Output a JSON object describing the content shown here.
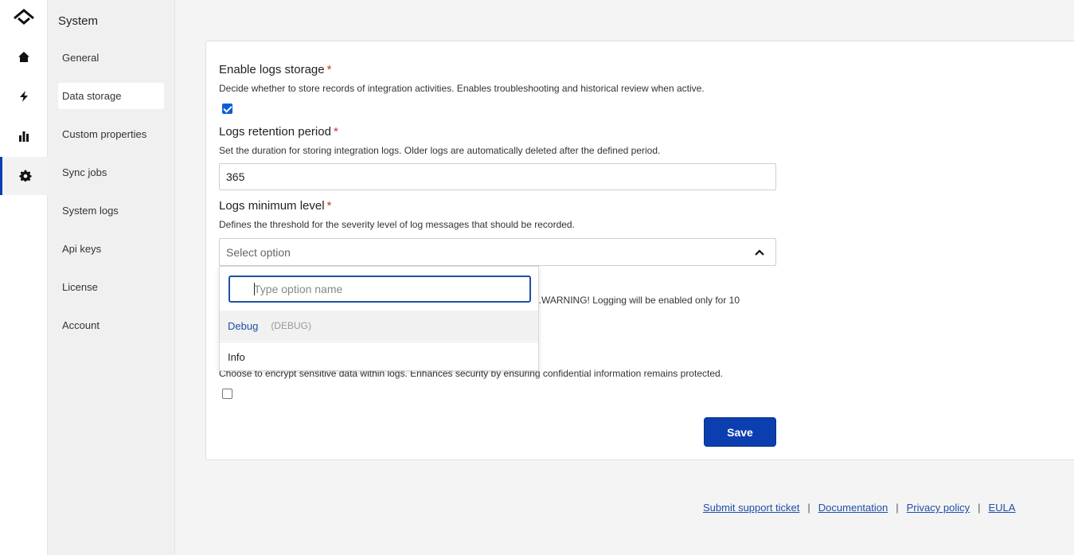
{
  "rail": {
    "items": [
      {
        "icon": "home-icon"
      },
      {
        "icon": "lightning-icon"
      },
      {
        "icon": "bar-chart-icon"
      },
      {
        "icon": "gear-icon",
        "active": true
      }
    ],
    "active_color": "#0b3fb0"
  },
  "subnav": {
    "title": "System",
    "items": [
      {
        "label": "General"
      },
      {
        "label": "Data storage",
        "active": true
      },
      {
        "label": "Custom properties"
      },
      {
        "label": "Sync jobs"
      },
      {
        "label": "System logs"
      },
      {
        "label": "Api keys"
      },
      {
        "label": "License"
      },
      {
        "label": "Account"
      }
    ]
  },
  "form": {
    "logs_storage": {
      "label": "Enable logs storage",
      "required": "*",
      "description": "Decide whether to store records of integration activities. Enables troubleshooting and historical review when active.",
      "checked": true
    },
    "retention": {
      "label": "Logs retention period",
      "required": "*",
      "description": "Set the duration for storing integration logs. Older logs are automatically deleted after the defined period.",
      "value": "365"
    },
    "min_level": {
      "label": "Logs minimum level",
      "required": "*",
      "description": "Defines the threshold for the severity level of log messages that should be recorded.",
      "placeholder": "Select option",
      "dropdown": {
        "search_placeholder": "Type option name",
        "options": [
          {
            "label": "Debug",
            "code": "(DEBUG)",
            "highlighted": true
          },
          {
            "label": "Info"
          }
        ]
      }
    },
    "partial_warning": "g.WARNING! Logging will be enabled only for 10",
    "encrypt": {
      "description": "Choose to encrypt sensitive data within logs. Enhances security by ensuring confidential information remains protected.",
      "checked": false
    },
    "save_label": "Save",
    "accent_color": "#0b3fb0"
  },
  "footer": {
    "links": [
      "Submit support ticket",
      "Documentation",
      "Privacy policy",
      "EULA"
    ],
    "separator": "|"
  }
}
